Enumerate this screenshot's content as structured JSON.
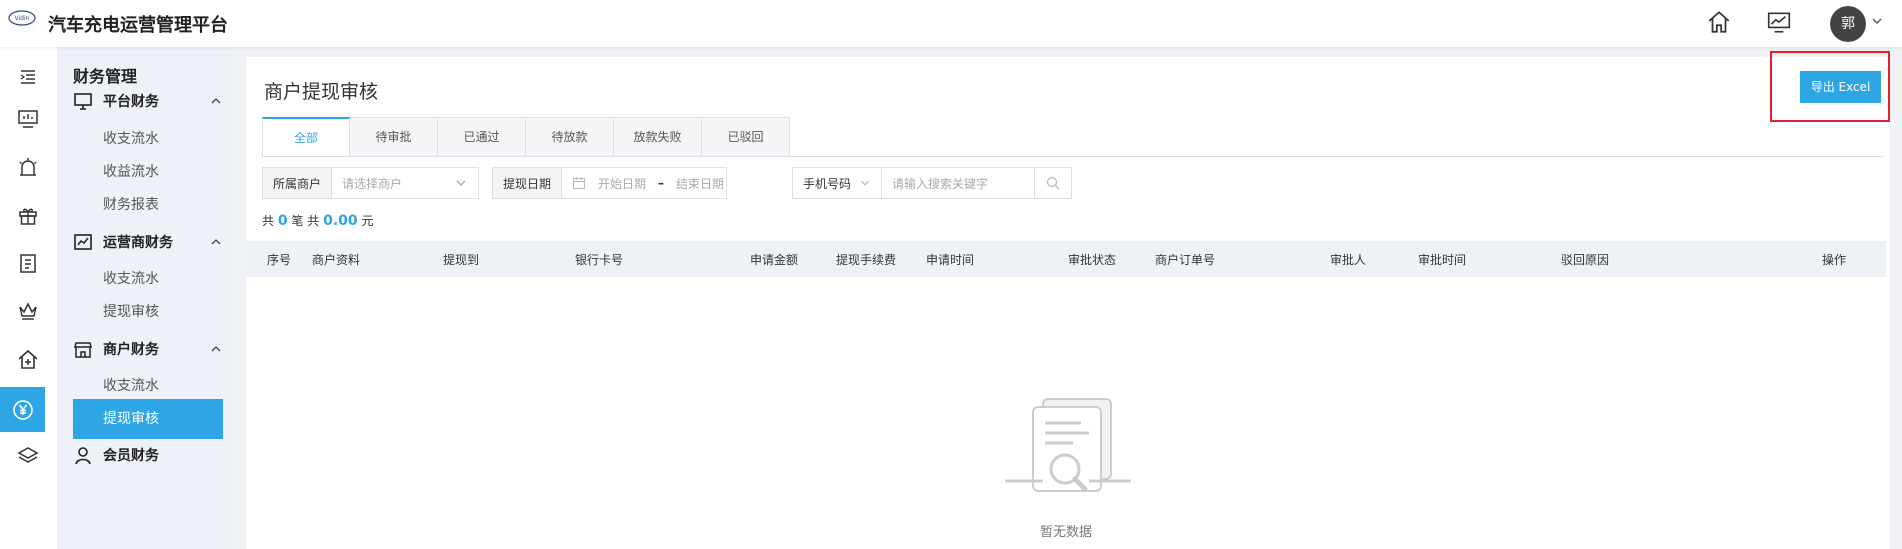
{
  "app": {
    "title": "汽车充电运营管理平台",
    "logo_text": "Vidin"
  },
  "header": {
    "avatar_text": "郭"
  },
  "subnav": {
    "title": "财务管理",
    "groups": [
      {
        "label": "平台财务",
        "items": [
          "收支流水",
          "收益流水",
          "财务报表"
        ]
      },
      {
        "label": "运营商财务",
        "items": [
          "收支流水",
          "提现审核"
        ]
      },
      {
        "label": "商户财务",
        "items": [
          "收支流水",
          "提现审核"
        ]
      },
      {
        "label": "会员财务",
        "items": []
      }
    ]
  },
  "page": {
    "title": "商户提现审核",
    "export_label": "导出 Excel",
    "tabs": [
      "全部",
      "待审批",
      "已通过",
      "待放款",
      "放款失败",
      "已驳回"
    ],
    "active_tab": 0
  },
  "filters": {
    "merchant_label": "所属商户",
    "merchant_placeholder": "请选择商户",
    "date_label": "提现日期",
    "start_placeholder": "开始日期",
    "end_placeholder": "结束日期",
    "date_separator": "–",
    "phone_select": "手机号码",
    "keyword_placeholder": "请输入搜索关键字"
  },
  "summary": {
    "prefix": "共",
    "count": "0",
    "mid": "笔 共",
    "amount": "0.00",
    "suffix": "元"
  },
  "table": {
    "columns": [
      "序号",
      "商户资料",
      "提现到",
      "银行卡号",
      "申请金额",
      "提现手续费",
      "申请时间",
      "审批状态",
      "商户订单号",
      "审批人",
      "审批时间",
      "驳回原因",
      "操作"
    ],
    "empty_text": "暂无数据"
  },
  "colors": {
    "accent": "#2ea6e6",
    "highlight": "#e0222a"
  }
}
